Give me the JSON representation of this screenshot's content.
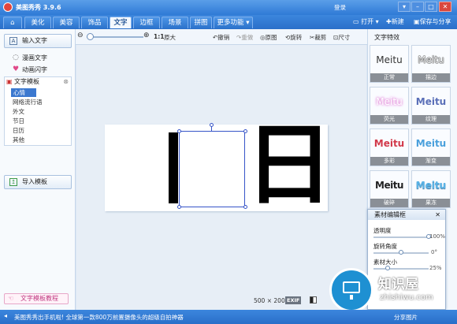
{
  "window": {
    "title": "美图秀秀 3.9.6",
    "login": "登录",
    "min": "–",
    "max": "□",
    "close": "✕"
  },
  "tabs": [
    {
      "label": "美化"
    },
    {
      "label": "美容"
    },
    {
      "label": "饰品"
    },
    {
      "label": "文字",
      "active": true
    },
    {
      "label": "边框"
    },
    {
      "label": "场景"
    },
    {
      "label": "拼图"
    },
    {
      "label": "更多功能"
    }
  ],
  "toolbar_right": {
    "open": "打开",
    "new": "新建",
    "save": "保存与分享"
  },
  "subbar": {
    "zoom_ratio": "1:1",
    "original_size": "原大",
    "undo": "撤销",
    "redo": "重做",
    "original": "原图",
    "rotate": "旋转",
    "crop": "裁剪",
    "size": "尺寸"
  },
  "left": {
    "input_text": "输入文字",
    "comic_text": "漫画文字",
    "animated_flash": "动画闪字",
    "template_title": "文字模板",
    "template_items": [
      "心情",
      "网络流行语",
      "外文",
      "节日",
      "日历",
      "其他"
    ],
    "import_template": "导入模板",
    "tutorial": "文字模板教程"
  },
  "canvas": {
    "glyph_left": "I",
    "glyph_right": "日",
    "size_w": "500",
    "size_x": "×",
    "size_h": "200",
    "exif": "EXIF"
  },
  "right": {
    "title": "文字特效",
    "effects": [
      {
        "sample": "Meitu",
        "label": "正常",
        "color": "#333333"
      },
      {
        "sample": "Meitu",
        "label": "描边",
        "color": "#111111"
      },
      {
        "sample": "Meitu",
        "label": "荧光",
        "color": "#e6a6e0"
      },
      {
        "sample": "Meitu",
        "label": "纹理",
        "color": "#5a6fb8"
      },
      {
        "sample": "Meitu",
        "label": "多彩",
        "color": "#d2394a"
      },
      {
        "sample": "Meitu",
        "label": "渐变",
        "color": "#4aa0dc"
      },
      {
        "sample": "Meitu",
        "label": "破碎",
        "color": "#222222"
      },
      {
        "sample": "Meitu",
        "label": "果冻",
        "color": "#5ab3e6"
      }
    ]
  },
  "editor": {
    "title": "素材编辑框",
    "opacity_label": "透明度",
    "opacity_value": "100%",
    "opacity": 1.0,
    "rotation_label": "旋转角度",
    "rotation_value": "0°",
    "rotation": 0.5,
    "size_label": "素材大小",
    "size_value": "25%",
    "size": 0.25
  },
  "watermark": {
    "text": "知识屋",
    "sub": "zhishiwu.com"
  },
  "bottom": {
    "ticker": "美图秀秀出手机啦! 全球第一款800万前置摄像头的超级自拍神器",
    "share": "分享图片"
  }
}
